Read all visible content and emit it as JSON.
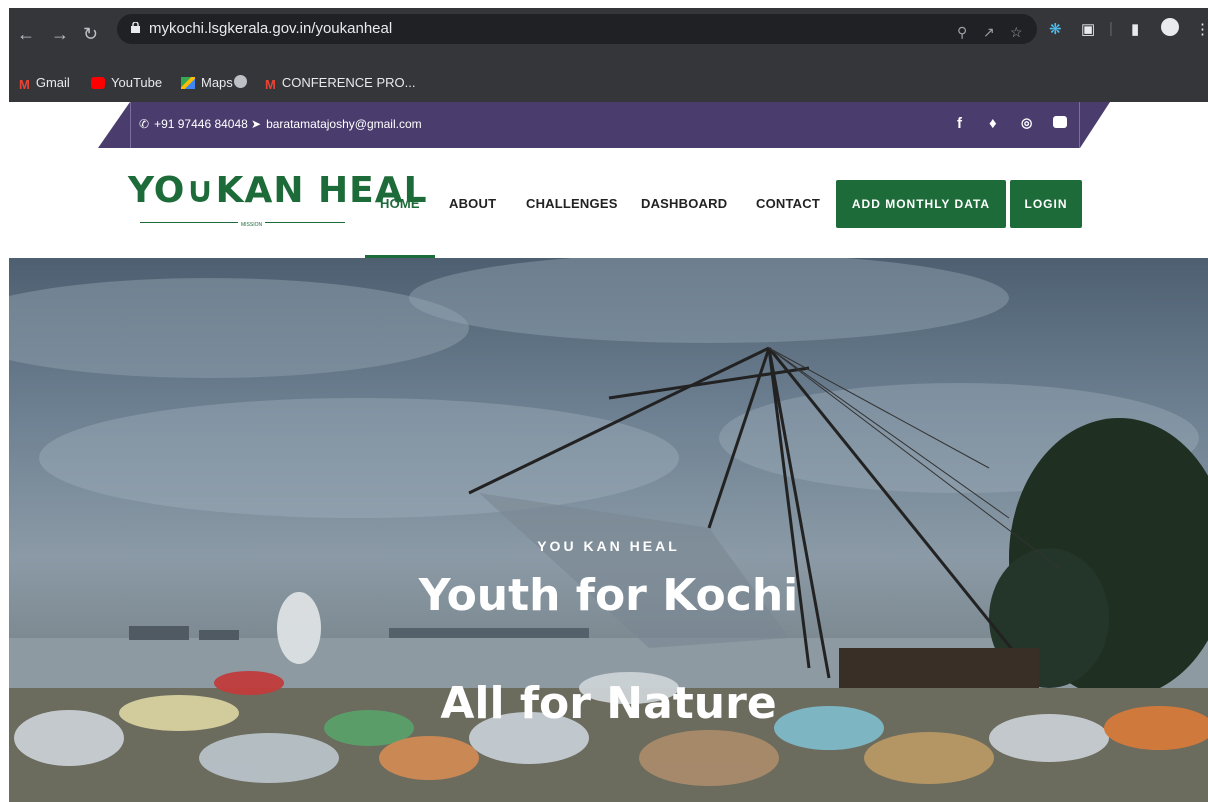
{
  "browser": {
    "url": "mykochi.lsgkerala.gov.in/youkanheal",
    "bookmarks": [
      {
        "label": "Gmail",
        "icon": "gmail-icon",
        "color": "#ea4335"
      },
      {
        "label": "YouTube",
        "icon": "youtube-icon",
        "color": "#ff0000"
      },
      {
        "label": "Maps",
        "icon": "maps-icon",
        "color": "#34a853"
      },
      {
        "label": "",
        "icon": "globe-icon",
        "color": "#bdc1c6"
      },
      {
        "label": "CONFERENCE PRO...",
        "icon": "gmail-icon",
        "color": "#ea4335"
      }
    ]
  },
  "infobar": {
    "phone": "+91 97446 84048",
    "email": "baratamatajoshy@gmail.com",
    "social": [
      "facebook-icon",
      "twitter-icon",
      "instagram-icon",
      "youtube-icon"
    ]
  },
  "header": {
    "logo_text": "YO∪KAN HEAL",
    "logo_sub": "MISSION",
    "nav": [
      "HOME",
      "ABOUT",
      "CHALLENGES",
      "DASHBOARD",
      "CONTACT"
    ],
    "active_nav": "HOME",
    "add_data_label": "ADD MONTHLY DATA",
    "login_label": "LOGIN"
  },
  "hero": {
    "kicker": "YOU KAN HEAL",
    "line1": "Youth for Kochi",
    "line2": "All for Nature"
  },
  "colors": {
    "brand_green": "#1e6b3a",
    "infobar_purple": "#4a3d6e",
    "chrome_dark": "#35363a"
  }
}
